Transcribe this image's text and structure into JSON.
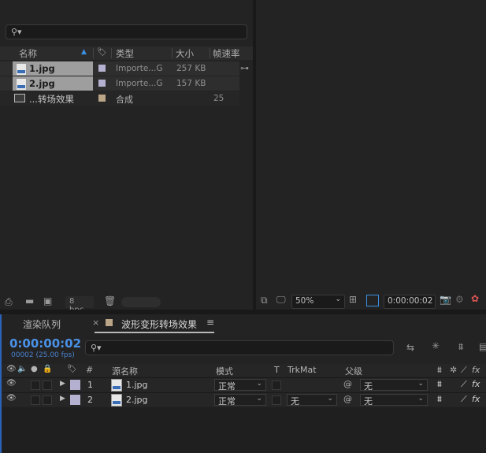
{
  "project": {
    "search_placeholder": "",
    "columns": {
      "name": "名称",
      "type": "类型",
      "size": "大小",
      "fps": "帧速率"
    },
    "items": [
      {
        "name": "1.jpg",
        "label_color": "#b4b0d0",
        "type": "Importe...G",
        "size": "257 KB",
        "fps": ""
      },
      {
        "name": "2.jpg",
        "label_color": "#b4b0d0",
        "type": "Importe...G",
        "size": "157 KB",
        "fps": ""
      },
      {
        "name": "...转场效果",
        "label_color": "#bba587",
        "type": "合成",
        "size": "",
        "fps": "25"
      }
    ],
    "bpc": "8 bpc"
  },
  "viewer": {
    "zoom": "50%",
    "timecode": "0:00:00:02"
  },
  "timeline": {
    "tabs": {
      "render_queue": "渲染队列",
      "comp": "波形变形转场效果"
    },
    "timecode": "0:00:00:02",
    "fps_text": "00002 (25.00 fps)",
    "headers": {
      "hash": "#",
      "source": "源名称",
      "mode": "模式",
      "t": "T",
      "trkmat": "TrkMat",
      "parent": "父级"
    },
    "layers": [
      {
        "num": "1",
        "name": "1.jpg",
        "label_color": "#b4b0d0",
        "mode": "正常",
        "trkmat": "",
        "parent": "无"
      },
      {
        "num": "2",
        "name": "2.jpg",
        "label_color": "#b4b0d0",
        "mode": "正常",
        "trkmat": "无",
        "parent": "无"
      }
    ]
  }
}
